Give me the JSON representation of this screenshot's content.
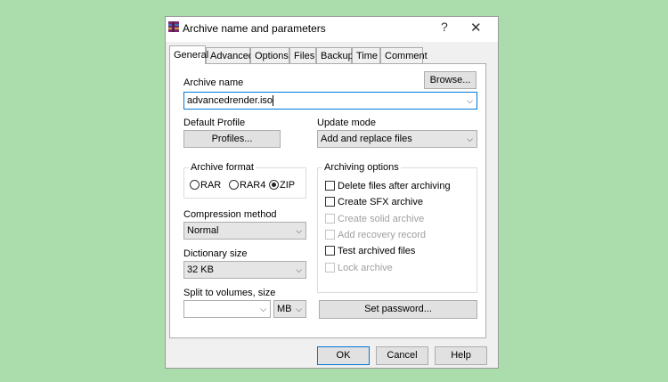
{
  "window": {
    "title": "Archive name and parameters",
    "help_glyph": "?",
    "close_glyph": "✕"
  },
  "tabs": [
    {
      "label": "General",
      "active": true
    },
    {
      "label": "Advanced",
      "active": false
    },
    {
      "label": "Options",
      "active": false
    },
    {
      "label": "Files",
      "active": false
    },
    {
      "label": "Backup",
      "active": false
    },
    {
      "label": "Time",
      "active": false
    },
    {
      "label": "Comment",
      "active": false
    }
  ],
  "general": {
    "archive_name_label": "Archive name",
    "browse_label": "Browse...",
    "archive_name_value": "advancedrender.iso",
    "default_profile_label": "Default Profile",
    "profiles_button_label": "Profiles...",
    "update_mode_label": "Update mode",
    "update_mode_value": "Add and replace files",
    "archive_format": {
      "title": "Archive format",
      "options": [
        {
          "label": "RAR",
          "selected": false
        },
        {
          "label": "RAR4",
          "selected": false
        },
        {
          "label": "ZIP",
          "selected": true
        }
      ]
    },
    "compression_method_label": "Compression method",
    "compression_method_value": "Normal",
    "dictionary_size_label": "Dictionary size",
    "dictionary_size_value": "32 KB",
    "split_label": "Split to volumes, size",
    "split_value": "",
    "split_unit": "MB",
    "archiving_options": {
      "title": "Archiving options",
      "items": [
        {
          "label": "Delete files after archiving",
          "checked": false,
          "enabled": true
        },
        {
          "label": "Create SFX archive",
          "checked": false,
          "enabled": true
        },
        {
          "label": "Create solid archive",
          "checked": false,
          "enabled": false
        },
        {
          "label": "Add recovery record",
          "checked": false,
          "enabled": false
        },
        {
          "label": "Test archived files",
          "checked": false,
          "enabled": true
        },
        {
          "label": "Lock archive",
          "checked": false,
          "enabled": false
        }
      ]
    },
    "set_password_label": "Set password..."
  },
  "footer": {
    "ok_label": "OK",
    "cancel_label": "Cancel",
    "help_label": "Help"
  },
  "colors": {
    "background": "#abdcab",
    "focus_border": "#0078d7"
  }
}
